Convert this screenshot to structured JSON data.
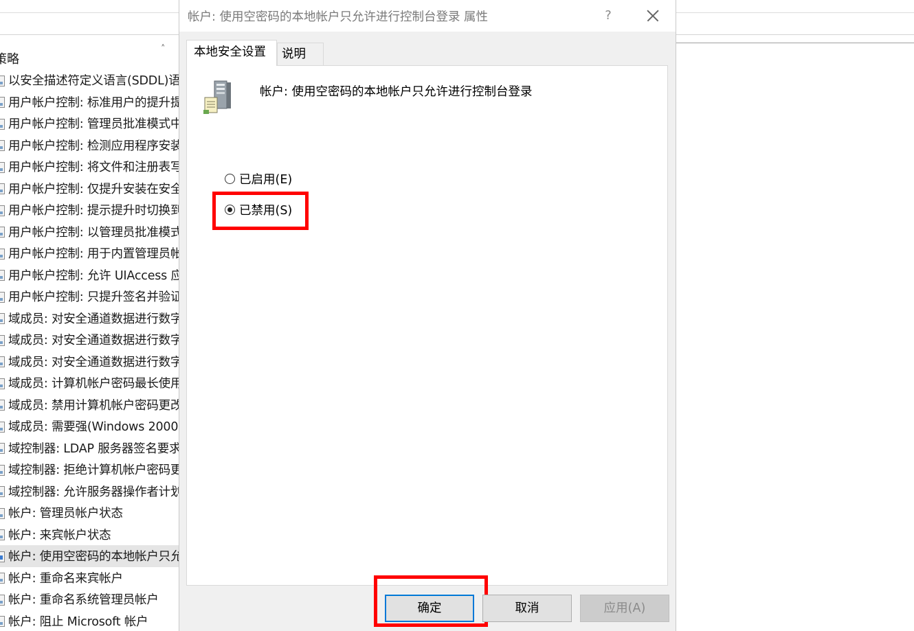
{
  "background": {
    "column_header": "策略",
    "policies": [
      {
        "label": "以安全描述符定义语言(SDDL)语"
      },
      {
        "label": "用户帐户控制: 标准用户的提升提"
      },
      {
        "label": "用户帐户控制: 管理员批准模式中"
      },
      {
        "label": "用户帐户控制: 检测应用程序安装"
      },
      {
        "label": "用户帐户控制: 将文件和注册表写"
      },
      {
        "label": "用户帐户控制: 仅提升安装在安全"
      },
      {
        "label": "用户帐户控制: 提示提升时切换到"
      },
      {
        "label": "用户帐户控制: 以管理员批准模式"
      },
      {
        "label": "用户帐户控制: 用于内置管理员帐"
      },
      {
        "label": "用户帐户控制: 允许 UIAccess 应"
      },
      {
        "label": "用户帐户控制: 只提升签名并验证"
      },
      {
        "label": "域成员: 对安全通道数据进行数字"
      },
      {
        "label": "域成员: 对安全通道数据进行数字"
      },
      {
        "label": "域成员: 对安全通道数据进行数字"
      },
      {
        "label": "域成员: 计算机帐户密码最长使用"
      },
      {
        "label": "域成员: 禁用计算机帐户密码更改"
      },
      {
        "label": "域成员: 需要强(Windows 2000"
      },
      {
        "label": "域控制器: LDAP 服务器签名要求"
      },
      {
        "label": "域控制器: 拒绝计算机帐户密码更"
      },
      {
        "label": "域控制器: 允许服务器操作者计划"
      },
      {
        "label": "帐户: 管理员帐户状态"
      },
      {
        "label": "帐户: 来宾帐户状态"
      },
      {
        "label": "帐户: 使用空密码的本地帐户只允",
        "selected": true
      },
      {
        "label": "帐户: 重命名来宾帐户"
      },
      {
        "label": "帐户: 重命名系统管理员帐户"
      },
      {
        "label": "帐户: 阻止 Microsoft 帐户"
      }
    ]
  },
  "dialog": {
    "title": "帐户: 使用空密码的本地帐户只允许进行控制台登录 属性",
    "help_label": "?",
    "tabs": [
      {
        "label": "本地安全设置",
        "active": true
      },
      {
        "label": "说明",
        "active": false
      }
    ],
    "policy_title": "帐户: 使用空密码的本地帐户只允许进行控制台登录",
    "options": {
      "enabled_label": "已启用(E)",
      "disabled_label": "已禁用(S)",
      "selected": "disabled"
    },
    "buttons": {
      "ok": "确定",
      "cancel": "取消",
      "apply": "应用(A)"
    }
  },
  "colors": {
    "highlight": "#ff0000",
    "focus_border": "#0078d7",
    "selected_row": "#e5e5e5"
  }
}
